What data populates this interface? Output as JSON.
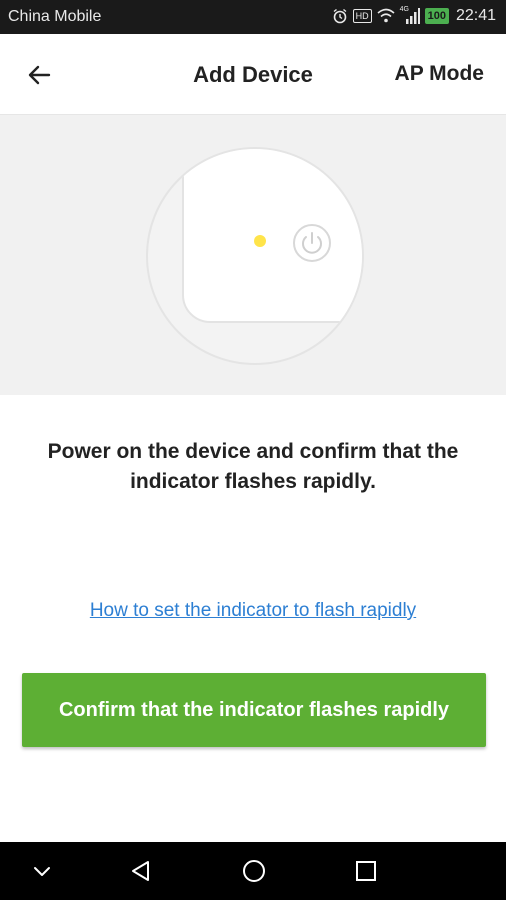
{
  "status_bar": {
    "carrier": "China Mobile",
    "signal_badge": "4G",
    "hd_badge": "HD",
    "battery": "100",
    "time": "22:41",
    "icons": [
      "alarm-icon",
      "hd-icon",
      "wifi-icon",
      "signal-icon",
      "battery-icon"
    ]
  },
  "header": {
    "title": "Add Device",
    "action": "AP Mode",
    "back_icon": "back-arrow-icon"
  },
  "illustration": {
    "icons": [
      "indicator-light",
      "power-icon"
    ],
    "led_color": "#ffe44a"
  },
  "instruction": "Power on the device and confirm that the indicator flashes rapidly.",
  "help_link": "How to set the indicator to flash rapidly",
  "confirm_button": "Confirm that the indicator flashes rapidly",
  "colors": {
    "accent": "#5daf34",
    "link": "#2d7fd3"
  },
  "nav_bar": {
    "icons": [
      "hide-keyboard-icon",
      "back-triangle-icon",
      "home-circle-icon",
      "recents-square-icon"
    ]
  }
}
